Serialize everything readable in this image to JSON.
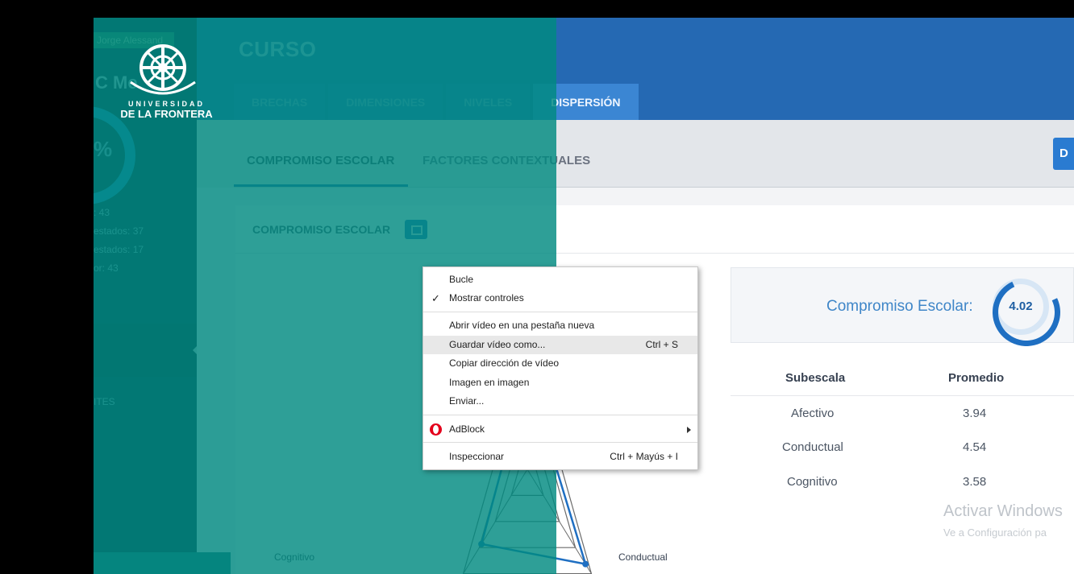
{
  "sidebar": {
    "user": "Jorge Alessand",
    "code": "C Me",
    "percent": "%",
    "stats": [
      ": 43",
      "estados: 37",
      "estados: 17",
      "or: 43"
    ],
    "section": "ITES"
  },
  "header": {
    "title": "CURSO",
    "tabs": [
      {
        "label": "BRECHAS",
        "active": false
      },
      {
        "label": "DIMENSIONES",
        "active": false
      },
      {
        "label": "NIVELES",
        "active": false
      },
      {
        "label": "DISPERSIÓN",
        "active": true
      }
    ]
  },
  "subnav": {
    "tabs": [
      {
        "label": "COMPROMISO ESCOLAR",
        "active": true
      },
      {
        "label": "FACTORES CONTEXTUALES",
        "active": false
      }
    ],
    "button_label": "D"
  },
  "card": {
    "title": "COMPROMISO ESCOLAR"
  },
  "logo": {
    "line1": "UNIVERSIDAD",
    "line2": "DE LA FRONTERA"
  },
  "chart_data": {
    "type": "radar",
    "axes": [
      "Afectivo",
      "Conductual",
      "Cognitivo"
    ],
    "visible_axis_labels": [
      "Cognitivo",
      "Conductual"
    ],
    "scale_max": 5,
    "rings": 4,
    "series": [
      {
        "values": [
          3.94,
          4.54,
          3.58
        ],
        "color": "#1f6fc2"
      }
    ]
  },
  "score": {
    "label": "Compromiso Escolar:",
    "value": "4.02",
    "fraction": 0.804
  },
  "table": {
    "headers": [
      "Subescala",
      "Promedio"
    ],
    "rows": [
      {
        "subescala": "Afectivo",
        "promedio": "3.94"
      },
      {
        "subescala": "Conductual",
        "promedio": "4.54"
      },
      {
        "subescala": "Cognitivo",
        "promedio": "3.58"
      }
    ]
  },
  "watermark": {
    "line1": "Activar Windows",
    "line2": "Ve a Configuración pa"
  },
  "context_menu": {
    "items": [
      {
        "label": "Bucle",
        "shortcut": ""
      },
      {
        "label": "Mostrar controles",
        "shortcut": "",
        "checked": true
      },
      {
        "label": "Abrir vídeo en una pestaña nueva",
        "shortcut": ""
      },
      {
        "label": "Guardar vídeo como...",
        "shortcut": "Ctrl + S"
      },
      {
        "label": "Copiar dirección de vídeo",
        "shortcut": ""
      },
      {
        "label": "Imagen en imagen",
        "shortcut": ""
      },
      {
        "label": "Enviar...",
        "shortcut": ""
      },
      {
        "label": "AdBlock",
        "shortcut": "",
        "submenu": true,
        "icon": "opera-icon"
      },
      {
        "label": "Inspeccionar",
        "shortcut": "Ctrl + Mayús + I"
      }
    ]
  }
}
